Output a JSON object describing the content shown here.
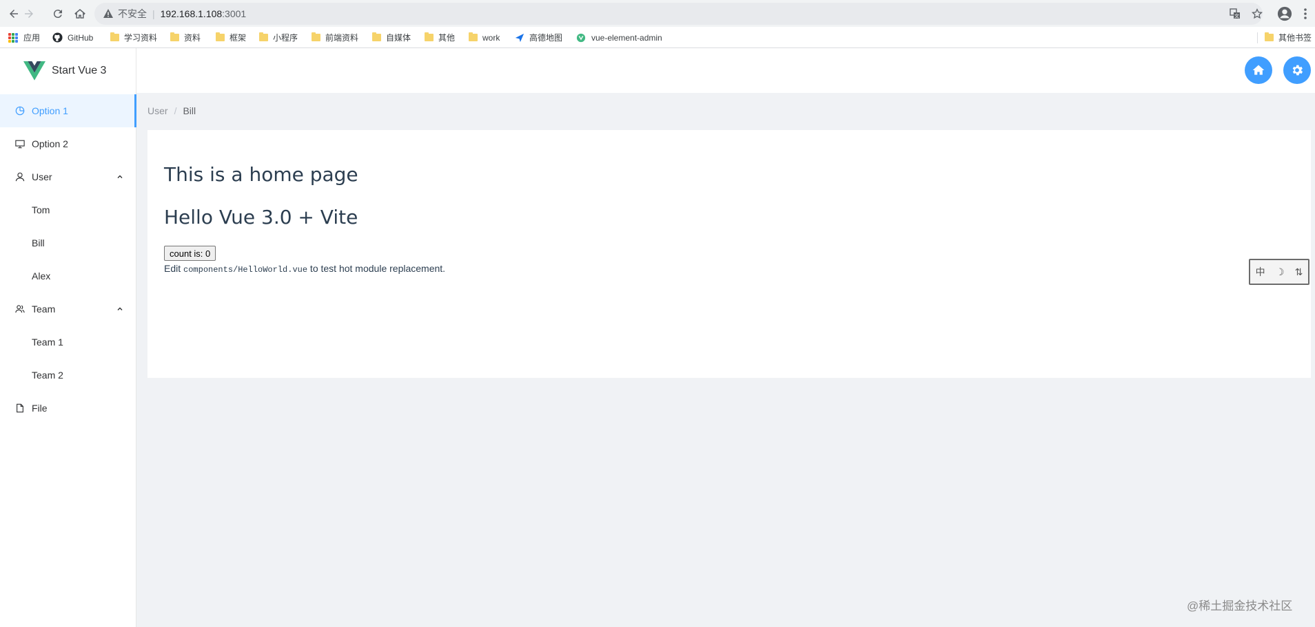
{
  "browser": {
    "security_label": "不安全",
    "url_host": "192.168.1.108",
    "url_port": ":3001"
  },
  "bookmarks": [
    {
      "label": "应用",
      "icon": "apps-grid-icon"
    },
    {
      "label": "GitHub",
      "icon": "github-icon"
    },
    {
      "label": "学习资料",
      "icon": "folder-icon"
    },
    {
      "label": "资料",
      "icon": "folder-icon"
    },
    {
      "label": "框架",
      "icon": "folder-icon"
    },
    {
      "label": "小程序",
      "icon": "folder-icon"
    },
    {
      "label": "前端资料",
      "icon": "folder-icon"
    },
    {
      "label": "自媒体",
      "icon": "folder-icon"
    },
    {
      "label": "其他",
      "icon": "folder-icon"
    },
    {
      "label": "work",
      "icon": "folder-icon"
    },
    {
      "label": "高德地图",
      "icon": "amap-icon"
    },
    {
      "label": "vue-element-admin",
      "icon": "vue-icon"
    },
    {
      "label": "其他书签",
      "icon": "folder-icon"
    }
  ],
  "header": {
    "title": "Start Vue 3"
  },
  "sidebar": {
    "items": [
      {
        "label": "Option 1",
        "icon": "pie-chart-icon",
        "active": true
      },
      {
        "label": "Option 2",
        "icon": "monitor-icon"
      },
      {
        "label": "User",
        "icon": "user-icon",
        "expanded": true
      },
      {
        "label": "Tom"
      },
      {
        "label": "Bill"
      },
      {
        "label": "Alex"
      },
      {
        "label": "Team",
        "icon": "team-icon",
        "expanded": true
      },
      {
        "label": "Team 1"
      },
      {
        "label": "Team 2"
      },
      {
        "label": "File",
        "icon": "document-icon"
      }
    ]
  },
  "breadcrumb": {
    "parent": "User",
    "separator": "/",
    "current": "Bill"
  },
  "content": {
    "heading": "This is a home page",
    "subheading": "Hello Vue 3.0 + Vite",
    "count_button": "count is: 0",
    "edit_prefix": "Edit ",
    "edit_code": "components/HelloWorld.vue",
    "edit_suffix": " to test hot module replacement."
  },
  "ime": {
    "char1": "中",
    "char2": "☽",
    "char3": "⇅"
  },
  "watermark": "@稀土掘金技术社区",
  "colors": {
    "accent": "#409eff",
    "active_bg": "#ecf5ff",
    "page_bg": "#f0f2f5"
  }
}
